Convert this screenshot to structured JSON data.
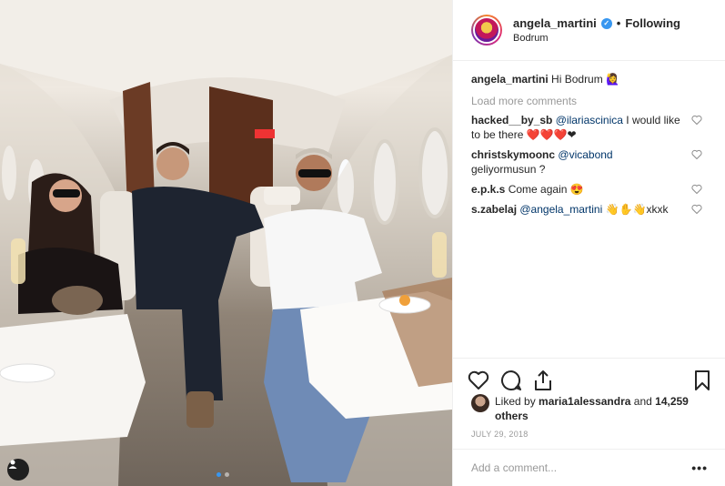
{
  "post": {
    "author": "angela_martini",
    "follow_separator": "•",
    "follow_label": "Following",
    "location": "Bodrum",
    "photo_description_icon": "user-tag-icon",
    "carousel": {
      "count": 2,
      "active_index": 0
    }
  },
  "caption": {
    "user": "angela_martini",
    "text": "Hi Bodrum 🙋‍♀️"
  },
  "load_more": "Load more comments",
  "comments": [
    {
      "user": "hacked__by_sb",
      "mention": "@ilariascinica",
      "text": " I would like to be there ❤️❤️❤️❤"
    },
    {
      "user": "christskymoonc",
      "mention": "@vicabond",
      "text": " geliyormusun ?"
    },
    {
      "user": "e.p.k.s",
      "mention": "",
      "text": "Come again 😍"
    },
    {
      "user": "s.zabelaj",
      "mention": "@angela_martini",
      "text": " 👋✋👋xkxk"
    }
  ],
  "likes": {
    "prefix": "Liked by ",
    "user": "maria1alessandra",
    "middle": " and ",
    "count": "14,259 others"
  },
  "date": "JULY 29, 2018",
  "add_comment_placeholder": "Add a comment...",
  "more_label": "•••",
  "colors": {
    "accent": "#3897f0",
    "mention": "#003569",
    "muted": "#999999"
  }
}
